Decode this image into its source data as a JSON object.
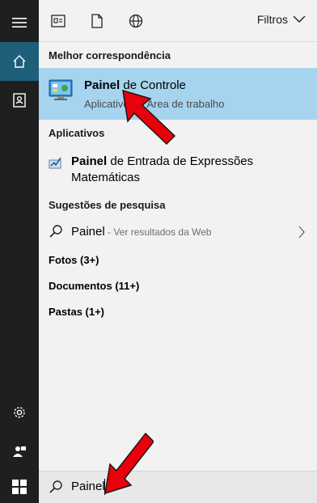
{
  "toolbar": {
    "filters_label": "Filtros"
  },
  "sections": {
    "best_match": "Melhor correspondência",
    "apps": "Aplicativos",
    "suggestions": "Sugestões de pesquisa"
  },
  "best_match": {
    "title_bold": "Painel",
    "title_rest": " de Controle",
    "subtitle": "Aplicativo da Área de trabalho"
  },
  "apps": [
    {
      "title_bold": "Painel",
      "title_rest": " de Entrada de Expressões Matemáticas"
    }
  ],
  "suggestion": {
    "query": "Painel",
    "note": " - Ver resultados da Web"
  },
  "categories": [
    {
      "label": "Fotos (3+)"
    },
    {
      "label": "Documentos (11+)"
    },
    {
      "label": "Pastas (1+)"
    }
  ],
  "search": {
    "value": "Painel"
  },
  "colors": {
    "rail": "#1f1f1f",
    "rail_active": "#1e5f7a",
    "selection": "#a6d4ee",
    "arrow": "#e8000b"
  },
  "icons": {
    "rail": [
      "hamburger-menu-icon",
      "home-icon",
      "contact-card-icon",
      "gear-icon",
      "user-feedback-icon",
      "windows-logo-icon"
    ],
    "toolbar": [
      "news-apps-icon",
      "document-icon",
      "globe-icon",
      "chevron-down-icon"
    ]
  }
}
